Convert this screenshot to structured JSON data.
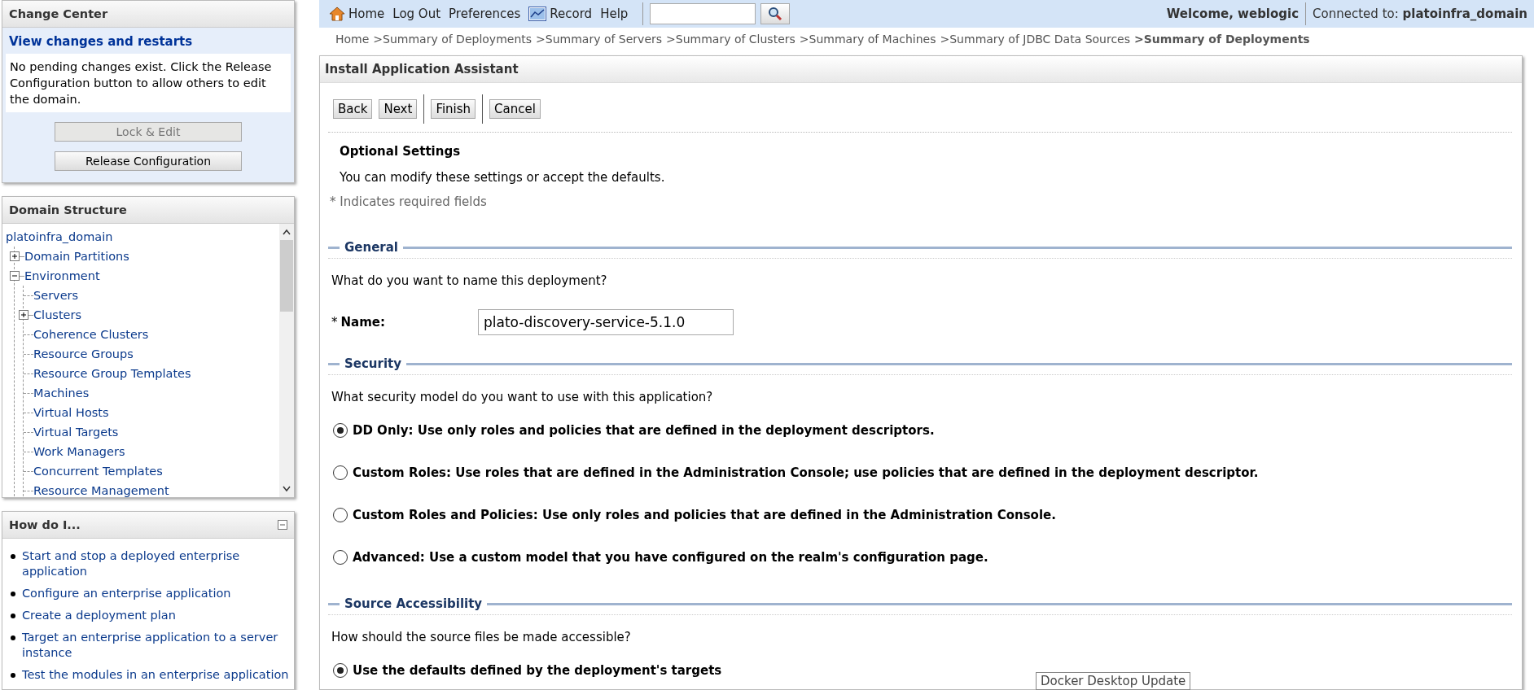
{
  "change_center": {
    "title": "Change Center",
    "link": "View changes and restarts",
    "message": "No pending changes exist. Click the Release Configuration button to allow others to edit the domain.",
    "buttons": [
      {
        "label": "Lock & Edit",
        "disabled": true
      },
      {
        "label": "Release Configuration",
        "disabled": false
      }
    ]
  },
  "domain_structure": {
    "title": "Domain Structure",
    "tree": {
      "label": "platoinfra_domain",
      "children": [
        {
          "label": "Domain Partitions",
          "expanded": false
        },
        {
          "label": "Environment",
          "expanded": true,
          "children": [
            {
              "label": "Servers"
            },
            {
              "label": "Clusters",
              "expanded": false
            },
            {
              "label": "Coherence Clusters"
            },
            {
              "label": "Resource Groups"
            },
            {
              "label": "Resource Group Templates"
            },
            {
              "label": "Machines"
            },
            {
              "label": "Virtual Hosts"
            },
            {
              "label": "Virtual Targets"
            },
            {
              "label": "Work Managers"
            },
            {
              "label": "Concurrent Templates"
            },
            {
              "label": "Resource Management"
            }
          ]
        }
      ]
    }
  },
  "how_do_i": {
    "title": "How do I...",
    "links": [
      "Start and stop a deployed enterprise application",
      "Configure an enterprise application",
      "Create a deployment plan",
      "Target an enterprise application to a server instance",
      "Test the modules in an enterprise application"
    ]
  },
  "top_bar": {
    "links": [
      {
        "label": "Home",
        "kind": "home"
      },
      {
        "label": "Log Out",
        "kind": "text"
      },
      {
        "label": "Preferences",
        "kind": "text"
      },
      {
        "label": "Record",
        "kind": "record"
      },
      {
        "label": "Help",
        "kind": "text"
      }
    ],
    "welcome": "Welcome, weblogic",
    "connected_label": "Connected to:",
    "domain": "platoinfra_domain"
  },
  "breadcrumb": [
    {
      "label": "Home",
      "current": false
    },
    {
      "label": ">Summary of Deployments",
      "current": false
    },
    {
      "label": ">Summary of Servers",
      "current": false
    },
    {
      "label": ">Summary of Clusters",
      "current": false
    },
    {
      "label": ">Summary of Machines",
      "current": false
    },
    {
      "label": ">Summary of JDBC Data Sources",
      "current": false
    },
    {
      "label": ">Summary of Deployments",
      "current": true
    }
  ],
  "assistant": {
    "title": "Install Application Assistant",
    "button_groups": [
      [
        "Back",
        "Next"
      ],
      [
        "Finish"
      ],
      [
        "Cancel"
      ]
    ],
    "heading": "Optional Settings",
    "intro": "You can modify these settings or accept the defaults.",
    "required_note": "* Indicates required fields",
    "sections": [
      {
        "title": "General",
        "question": "What do you want to name this deployment?",
        "kind": "field",
        "field": {
          "required_mark": "*",
          "label": "Name:",
          "value": "plato-discovery-service-5.1.0"
        }
      },
      {
        "title": "Security",
        "question": "What security model do you want to use with this application?",
        "kind": "radios",
        "options": [
          {
            "label": "DD Only: Use only roles and policies that are defined in the deployment descriptors.",
            "selected": true
          },
          {
            "label": "Custom Roles: Use roles that are defined in the Administration Console; use policies that are defined in the deployment descriptor.",
            "selected": false
          },
          {
            "label": "Custom Roles and Policies: Use only roles and policies that are defined in the Administration Console.",
            "selected": false
          },
          {
            "label": "Advanced: Use a custom model that you have configured on the realm's configuration page.",
            "selected": false
          }
        ]
      },
      {
        "title": "Source Accessibility",
        "question": "How should the source files be made accessible?",
        "kind": "radios",
        "options": [
          {
            "label": "Use the defaults defined by the deployment's targets",
            "selected": true
          }
        ]
      }
    ]
  },
  "tooltip": "Docker Desktop Update"
}
